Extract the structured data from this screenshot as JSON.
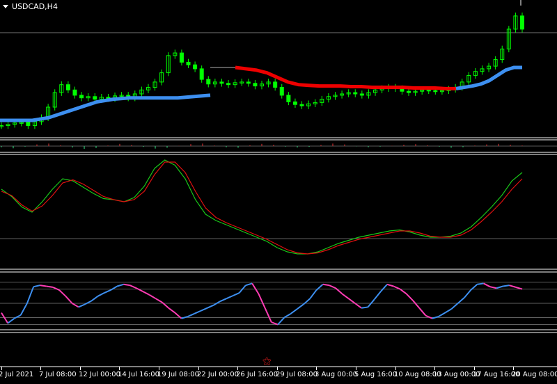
{
  "window": {
    "title": "USDCAD,H4"
  },
  "colors": {
    "background": "#000000",
    "candle": "#00ff00",
    "trend_up": "#3d8ff0",
    "trend_down": "#ee0000",
    "osc_fast": "#19c819",
    "osc_slow": "#e01010",
    "stoch_up": "#3d8ff0",
    "stoch_down": "#ff3cb4",
    "grid": "#808080",
    "separator": "#c8c8c8"
  },
  "time_axis": {
    "labels": [
      "2 Jul 2021",
      "7 Jul 08:00",
      "12 Jul 00:00",
      "14 Jul 16:00",
      "19 Jul 08:00",
      "22 Jul 00:00",
      "26 Jul 16:00",
      "29 Jul 08:00",
      "3 Aug 00:00",
      "5 Aug 16:00",
      "10 Aug 08:00",
      "13 Aug 00:00",
      "17 Aug 16:00",
      "20 Aug 08:00"
    ]
  },
  "markers": {
    "event_icon": "event-flag-icon"
  },
  "chart_data": [
    {
      "type": "candlestick",
      "symbol": "USDCAD",
      "timeframe": "H4",
      "series": [
        {
          "name": "Close",
          "values": [
            12.0,
            14.0,
            16.0,
            17.0,
            12.0,
            18.0,
            24.0,
            40.0,
            62.0,
            74.0,
            66.0,
            58.0,
            54.0,
            56.0,
            52.0,
            55.0,
            53.0,
            57.0,
            58.0,
            54.0,
            60.0,
            66.0,
            70.0,
            78.0,
            92.0,
            118.0,
            122.0,
            108.0,
            104.0,
            98.0,
            82.0,
            75.0,
            78.0,
            76.0,
            74.0,
            77.0,
            78.0,
            76.0,
            72.0,
            75.0,
            78.0,
            70.0,
            58.0,
            48.0,
            44.0,
            42.0,
            45.0,
            47.0,
            52.0,
            56.0,
            58.0,
            60.0,
            62.0,
            60.0,
            58.0,
            62.0,
            66.0,
            68.0,
            70.0,
            68.0,
            64.0,
            62.0,
            64.0,
            66.0,
            65.0,
            64.0,
            65.0,
            67.0,
            70.0,
            78.0,
            88.0,
            94.0,
            98.0,
            102.0,
            112.0,
            128.0,
            158.0,
            178.0,
            158.0
          ]
        },
        {
          "name": "Trend",
          "up": [
            20,
            20,
            20,
            24,
            32,
            40,
            48,
            52,
            54,
            54,
            54,
            54,
            56,
            58,
            62,
            66,
            76,
            94,
            98,
            100,
            100
          ],
          "down": [
            100,
            98,
            96,
            92,
            85,
            78,
            74,
            73,
            72,
            72,
            72,
            71,
            71,
            70,
            70,
            70,
            70,
            69,
            69,
            69,
            68,
            68
          ]
        }
      ]
    },
    {
      "type": "histogram",
      "values": [
        -0.4,
        -0.8,
        -0.2,
        0.6,
        0.9,
        0.3,
        -0.5,
        -1.0,
        -0.7,
        0.2,
        0.8,
        0.4,
        -0.3,
        -0.9,
        -0.6,
        0.1,
        0.7,
        0.9,
        0.2,
        -0.4,
        -0.6,
        0.3,
        0.8,
        0.5,
        -0.2,
        -0.5,
        -0.3,
        0.4,
        0.9,
        0.6,
        -0.1,
        -0.4,
        -0.2,
        0.1,
        0.5,
        0.7,
        0.3,
        -0.2,
        -0.6,
        -0.4,
        0.2,
        0.6,
        0.8,
        0.5,
        0.2
      ]
    },
    {
      "type": "line",
      "series": [
        {
          "name": "Fast",
          "values": [
            0.72,
            0.65,
            0.55,
            0.5,
            0.6,
            0.72,
            0.82,
            0.8,
            0.74,
            0.68,
            0.63,
            0.62,
            0.6,
            0.64,
            0.75,
            0.92,
            1.0,
            0.95,
            0.82,
            0.62,
            0.48,
            0.42,
            0.38,
            0.34,
            0.3,
            0.26,
            0.22,
            0.16,
            0.12,
            0.1,
            0.1,
            0.12,
            0.16,
            0.2,
            0.23,
            0.26,
            0.28,
            0.3,
            0.32,
            0.33,
            0.31,
            0.28,
            0.26,
            0.26,
            0.27,
            0.3,
            0.36,
            0.45,
            0.55,
            0.66,
            0.8,
            0.88
          ]
        },
        {
          "name": "Slow",
          "values": [
            0.7,
            0.66,
            0.57,
            0.51,
            0.56,
            0.66,
            0.78,
            0.81,
            0.77,
            0.71,
            0.65,
            0.62,
            0.6,
            0.62,
            0.7,
            0.86,
            0.98,
            0.98,
            0.88,
            0.7,
            0.54,
            0.45,
            0.4,
            0.36,
            0.32,
            0.28,
            0.24,
            0.19,
            0.14,
            0.11,
            0.1,
            0.11,
            0.14,
            0.18,
            0.21,
            0.24,
            0.26,
            0.28,
            0.3,
            0.32,
            0.32,
            0.3,
            0.27,
            0.26,
            0.26,
            0.28,
            0.33,
            0.41,
            0.5,
            0.6,
            0.72,
            0.82
          ]
        }
      ]
    },
    {
      "type": "line",
      "ylim": [
        0,
        100
      ],
      "levels": [
        20,
        50,
        80
      ],
      "series": [
        {
          "name": "Stochastic",
          "values": [
            30,
            8,
            18,
            25,
            50,
            85,
            88,
            86,
            84,
            78,
            65,
            50,
            42,
            48,
            55,
            65,
            72,
            78,
            86,
            90,
            88,
            82,
            75,
            68,
            60,
            52,
            40,
            30,
            18,
            22,
            28,
            34,
            40,
            46,
            54,
            60,
            66,
            72,
            88,
            92,
            70,
            40,
            10,
            5,
            20,
            28,
            38,
            48,
            60,
            78,
            90,
            88,
            82,
            70,
            60,
            50,
            40,
            42,
            58,
            75,
            90,
            86,
            80,
            70,
            56,
            40,
            24,
            18,
            22,
            30,
            38,
            50,
            62,
            78,
            90,
            92,
            85,
            82,
            86,
            88,
            84,
            80
          ]
        }
      ]
    }
  ]
}
